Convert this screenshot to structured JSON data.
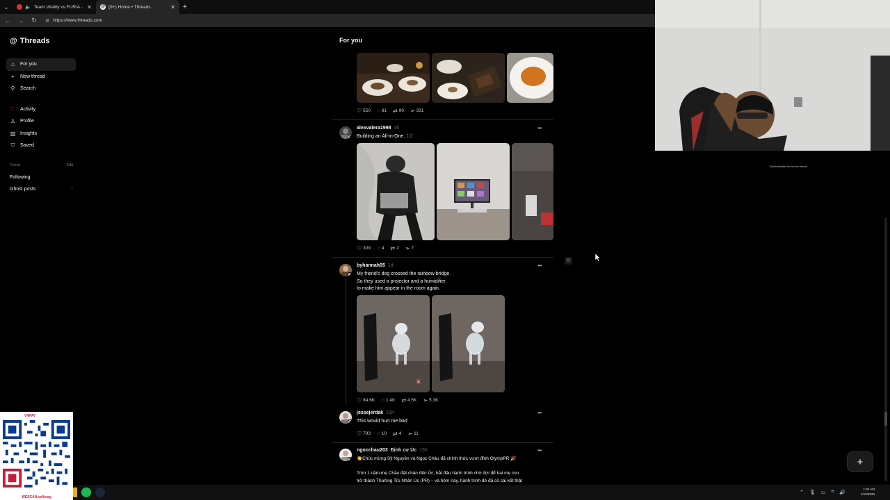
{
  "browser": {
    "tabs": [
      {
        "title": "Team Vitality vs FURIA - IEM R",
        "active": false
      },
      {
        "title": "(9+) Home • Threads",
        "active": true
      }
    ],
    "url": "https://www.threads.com"
  },
  "sidebar": {
    "brand": "Threads",
    "nav": [
      {
        "label": "For you",
        "icon": "home-icon"
      },
      {
        "label": "New thread",
        "icon": "plus-icon"
      },
      {
        "label": "Search",
        "icon": "search-icon"
      },
      {
        "label": "Activity",
        "icon": "heart-icon"
      },
      {
        "label": "Profile",
        "icon": "person-icon"
      },
      {
        "label": "Insights",
        "icon": "chart-icon"
      },
      {
        "label": "Saved",
        "icon": "bookmark-icon"
      }
    ],
    "feeds_label": "Feeds",
    "feeds_edit": "Edit",
    "feeds": [
      {
        "label": "Following"
      },
      {
        "label": "Ghost posts"
      }
    ]
  },
  "feed": {
    "title": "For you",
    "posts": [
      {
        "stats": {
          "likes": "550",
          "replies": "81",
          "reposts": "90",
          "shares": "331"
        }
      },
      {
        "username": "alexvalera1998",
        "time": "3h",
        "text": "Building an All-in-One.",
        "fraction": "1/2",
        "stats": {
          "likes": "309",
          "replies": "4",
          "reposts": "2",
          "shares": "7"
        }
      },
      {
        "username": "byhannah05",
        "time": "1d",
        "text": "My friend's dog crossed the rainbow bridge.\nSo they used a projector and a humidifier\nto make him appear in the room again.",
        "stats": {
          "likes": "84.6K",
          "replies": "1.4K",
          "reposts": "4.5K",
          "shares": "5.3K"
        }
      },
      {
        "username": "jessejerdak",
        "time": "21h",
        "text": "This would hurt me bad",
        "stats": {
          "likes": "793",
          "replies": "10",
          "reposts": "4",
          "shares": "11"
        }
      },
      {
        "username": "ngocchau203",
        "extra": "Định cư Úc",
        "time": "13h",
        "text": "👏Chúc mừng Sỹ Nguyên và Ngọc Châu đã chính thức vượt đỉnh OlympPR 🎉\n\nTròn 1 năm mẹ Châu đặt chân đến Úc, bắt đầu hành trình chờ đợi để hai mẹ con\ntrở thành Thường Trú Nhân Úc (PR) – và hôm nay, hành trình đó đã có cái kết thật"
      }
    ]
  },
  "overlay": {
    "chat_note": "Chat is disabled for this live stream.",
    "qr_label": "WESCAN.vn/hoag",
    "qr_brand": "VNPAY"
  },
  "taskbar": {
    "time": "1:00 AM",
    "date": "4/19/2026"
  },
  "colors": {
    "background": "#000000",
    "accent": "#ff3040",
    "text": "#f3f5f7"
  }
}
